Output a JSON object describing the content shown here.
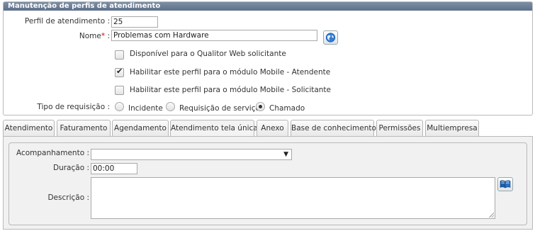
{
  "panel": {
    "title": "Manutenção de perfis de atendimento"
  },
  "form": {
    "perfil_label": "Perfil de atendimento :",
    "perfil_value": "25",
    "nome_label": "Nome",
    "nome_req": "*",
    "nome_colon": ":",
    "nome_value": "Problemas com Hardware",
    "checkboxes": [
      {
        "label": "Disponível para o Qualitor Web solicitante",
        "checked": false
      },
      {
        "label": "Habilitar este perfil para o módulo Mobile - Atendente",
        "checked": true
      },
      {
        "label": "Habilitar este perfil para o módulo Mobile - Solicitante",
        "checked": false
      }
    ],
    "tipo_label": "Tipo de requisição :",
    "radios": [
      {
        "label": "Incidente",
        "selected": false
      },
      {
        "label": "Requisição de serviço",
        "selected": false
      },
      {
        "label": "Chamado",
        "selected": true
      }
    ],
    "tick": "✔"
  },
  "tabs": [
    {
      "label": "Atendimento",
      "active": false
    },
    {
      "label": "Faturamento",
      "active": false
    },
    {
      "label": "Agendamento",
      "active": false
    },
    {
      "label": "Atendimento tela única",
      "active": true
    },
    {
      "label": "Anexo",
      "active": false
    },
    {
      "label": "Base de conhecimento",
      "active": false
    },
    {
      "label": "Permissões",
      "active": false
    },
    {
      "label": "Multiempresa",
      "active": false
    }
  ],
  "tabcontent": {
    "acomp_label": "Acompanhamento :",
    "acomp_value": "",
    "arrow": "▼",
    "duracao_label": "Duração :",
    "duracao_value": "00:00",
    "descricao_label": "Descrição :",
    "descricao_value": ""
  },
  "icons": {
    "globe": "globe-icon",
    "book": "book-icon"
  }
}
